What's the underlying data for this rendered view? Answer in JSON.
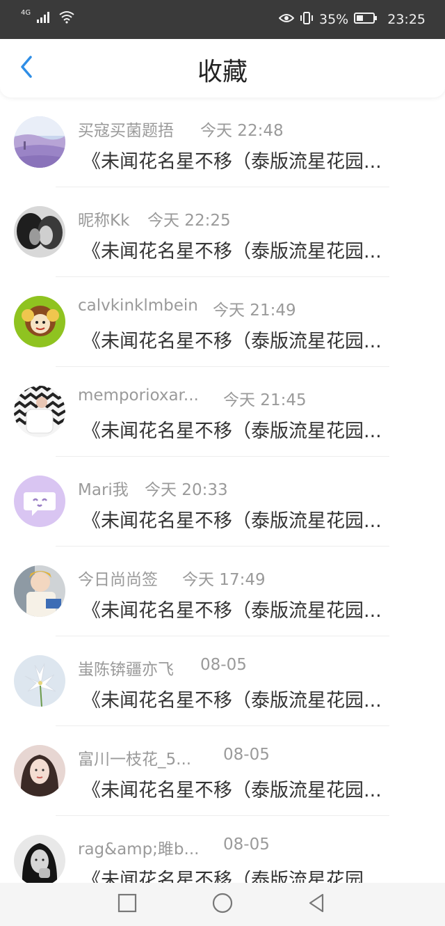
{
  "status_bar": {
    "network": "4G",
    "battery": "35%",
    "time": "23:25",
    "icons": [
      "signal-icon",
      "wifi-icon",
      "eye-icon",
      "vibrate-icon",
      "battery-icon"
    ]
  },
  "header": {
    "title": "收藏",
    "back_icon": "chevron-left-icon",
    "accent_color": "#2f8ee6"
  },
  "items": [
    {
      "name": "买寇买菌题捂",
      "time": "今天 22:48",
      "snippet": "《未闻花名星不移（泰版流星花园...",
      "avatar": "lavender-field"
    },
    {
      "name": "昵称Kk",
      "time": "今天 22:25",
      "snippet": "《未闻花名星不移（泰版流星花园...",
      "avatar": "couple-bw"
    },
    {
      "name": "calvkinklmbein",
      "time": "今天 21:49",
      "snippet": "《未闻花名星不移（泰版流星花园...",
      "avatar": "cartoon-sheep"
    },
    {
      "name": "memporioxar...",
      "time": "今天 21:45",
      "snippet": "《未闻花名星不移（泰版流星花园...",
      "avatar": "chevron-mug"
    },
    {
      "name": "Mari我",
      "time": "今天 20:33",
      "snippet": "《未闻花名星不移（泰版流星花园...",
      "avatar": "purple-chat"
    },
    {
      "name": "今日尚尚签",
      "time": "今天 17:49",
      "snippet": "《未闻花名星不移（泰版流星花园...",
      "avatar": "child-photo"
    },
    {
      "name": "蚩陈锛疆亦飞",
      "time": "08-05",
      "snippet": "《未闻花名星不移（泰版流星花园...",
      "avatar": "white-lily"
    },
    {
      "name": "富川一枝花_5...",
      "time": "08-05",
      "snippet": "《未闻花名星不移（泰版流星花园...",
      "avatar": "girl-portrait"
    },
    {
      "name": "rag&amp;雎b...",
      "time": "08-05",
      "snippet": "《未闻花名星不移（泰版流星花园...",
      "avatar": "bw-portrait"
    }
  ],
  "nav_bar": {
    "buttons": [
      "square-icon",
      "circle-icon",
      "triangle-back-icon"
    ]
  }
}
